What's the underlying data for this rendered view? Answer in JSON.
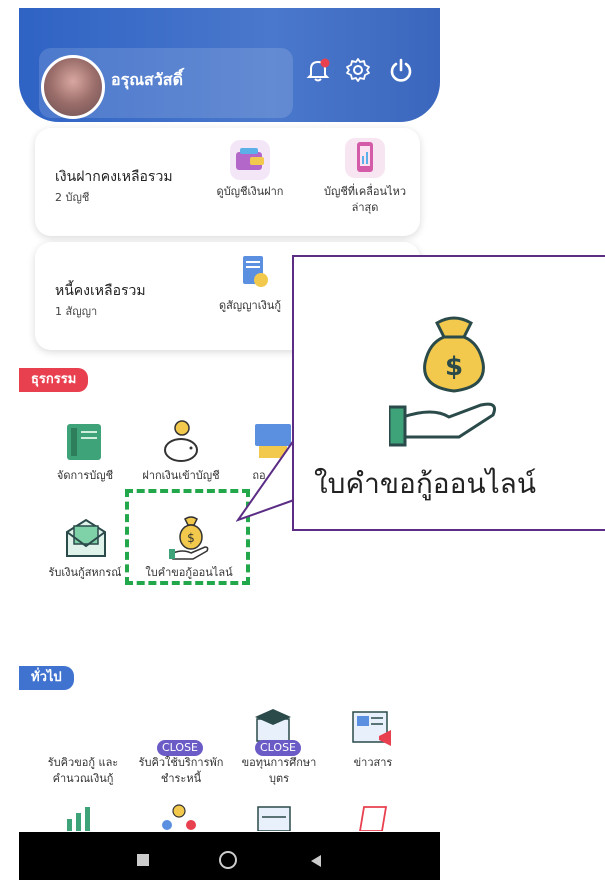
{
  "header": {
    "user_name": "อรุณสวัสดิ์",
    "icons": [
      "bell-icon",
      "gear-icon",
      "power-icon"
    ],
    "brand_color": "#2f63c4"
  },
  "deposit_card": {
    "title": "เงินฝากคงเหลือรวม",
    "subtitle": "2 บัญชี",
    "items": [
      {
        "label": "ดูบัญชีเงินฝาก"
      },
      {
        "label_line1": "บัญชีที่เคลื่อนไหว",
        "label_line2": "ล่าสุด"
      }
    ]
  },
  "loan_card": {
    "title": "หนี้คงเหลือรวม",
    "subtitle": "1 สัญญา",
    "items": [
      {
        "label": "ดูสัญญาเงินกู้"
      }
    ]
  },
  "transactions": {
    "tag": "ธุรกรรม",
    "tag_color": "#e8404f",
    "tiles": [
      {
        "label": "จัดการบัญชี"
      },
      {
        "label": "ฝากเงินเข้าบัญชี"
      },
      {
        "label": "ถอ"
      },
      {
        "label": "รับเงินกู้สหกรณ์"
      },
      {
        "label": "ใบคำขอกู้ออนไลน์"
      }
    ]
  },
  "general": {
    "tag": "ทั่วไป",
    "tag_color": "#3f73cf",
    "tiles": [
      {
        "line1": "รับคิวขอกู้ และ",
        "line2": "คำนวณเงินกู้"
      },
      {
        "line1": "รับคิวใช้บริการพัก",
        "line2": "ชำระหนี้",
        "badge": "CLOSE"
      },
      {
        "line1": "ขอทุนการศึกษา",
        "line2": "บุตร",
        "badge": "CLOSE"
      },
      {
        "line1": "ข่าวสาร"
      }
    ]
  },
  "callout": {
    "label": "ใบคำขอกู้ออนไลน์",
    "border_color": "#5b2d85",
    "highlight_color": "#22a84a"
  },
  "navbar": {
    "buttons": [
      "square-recents-icon",
      "circle-home-icon",
      "triangle-back-icon"
    ]
  }
}
